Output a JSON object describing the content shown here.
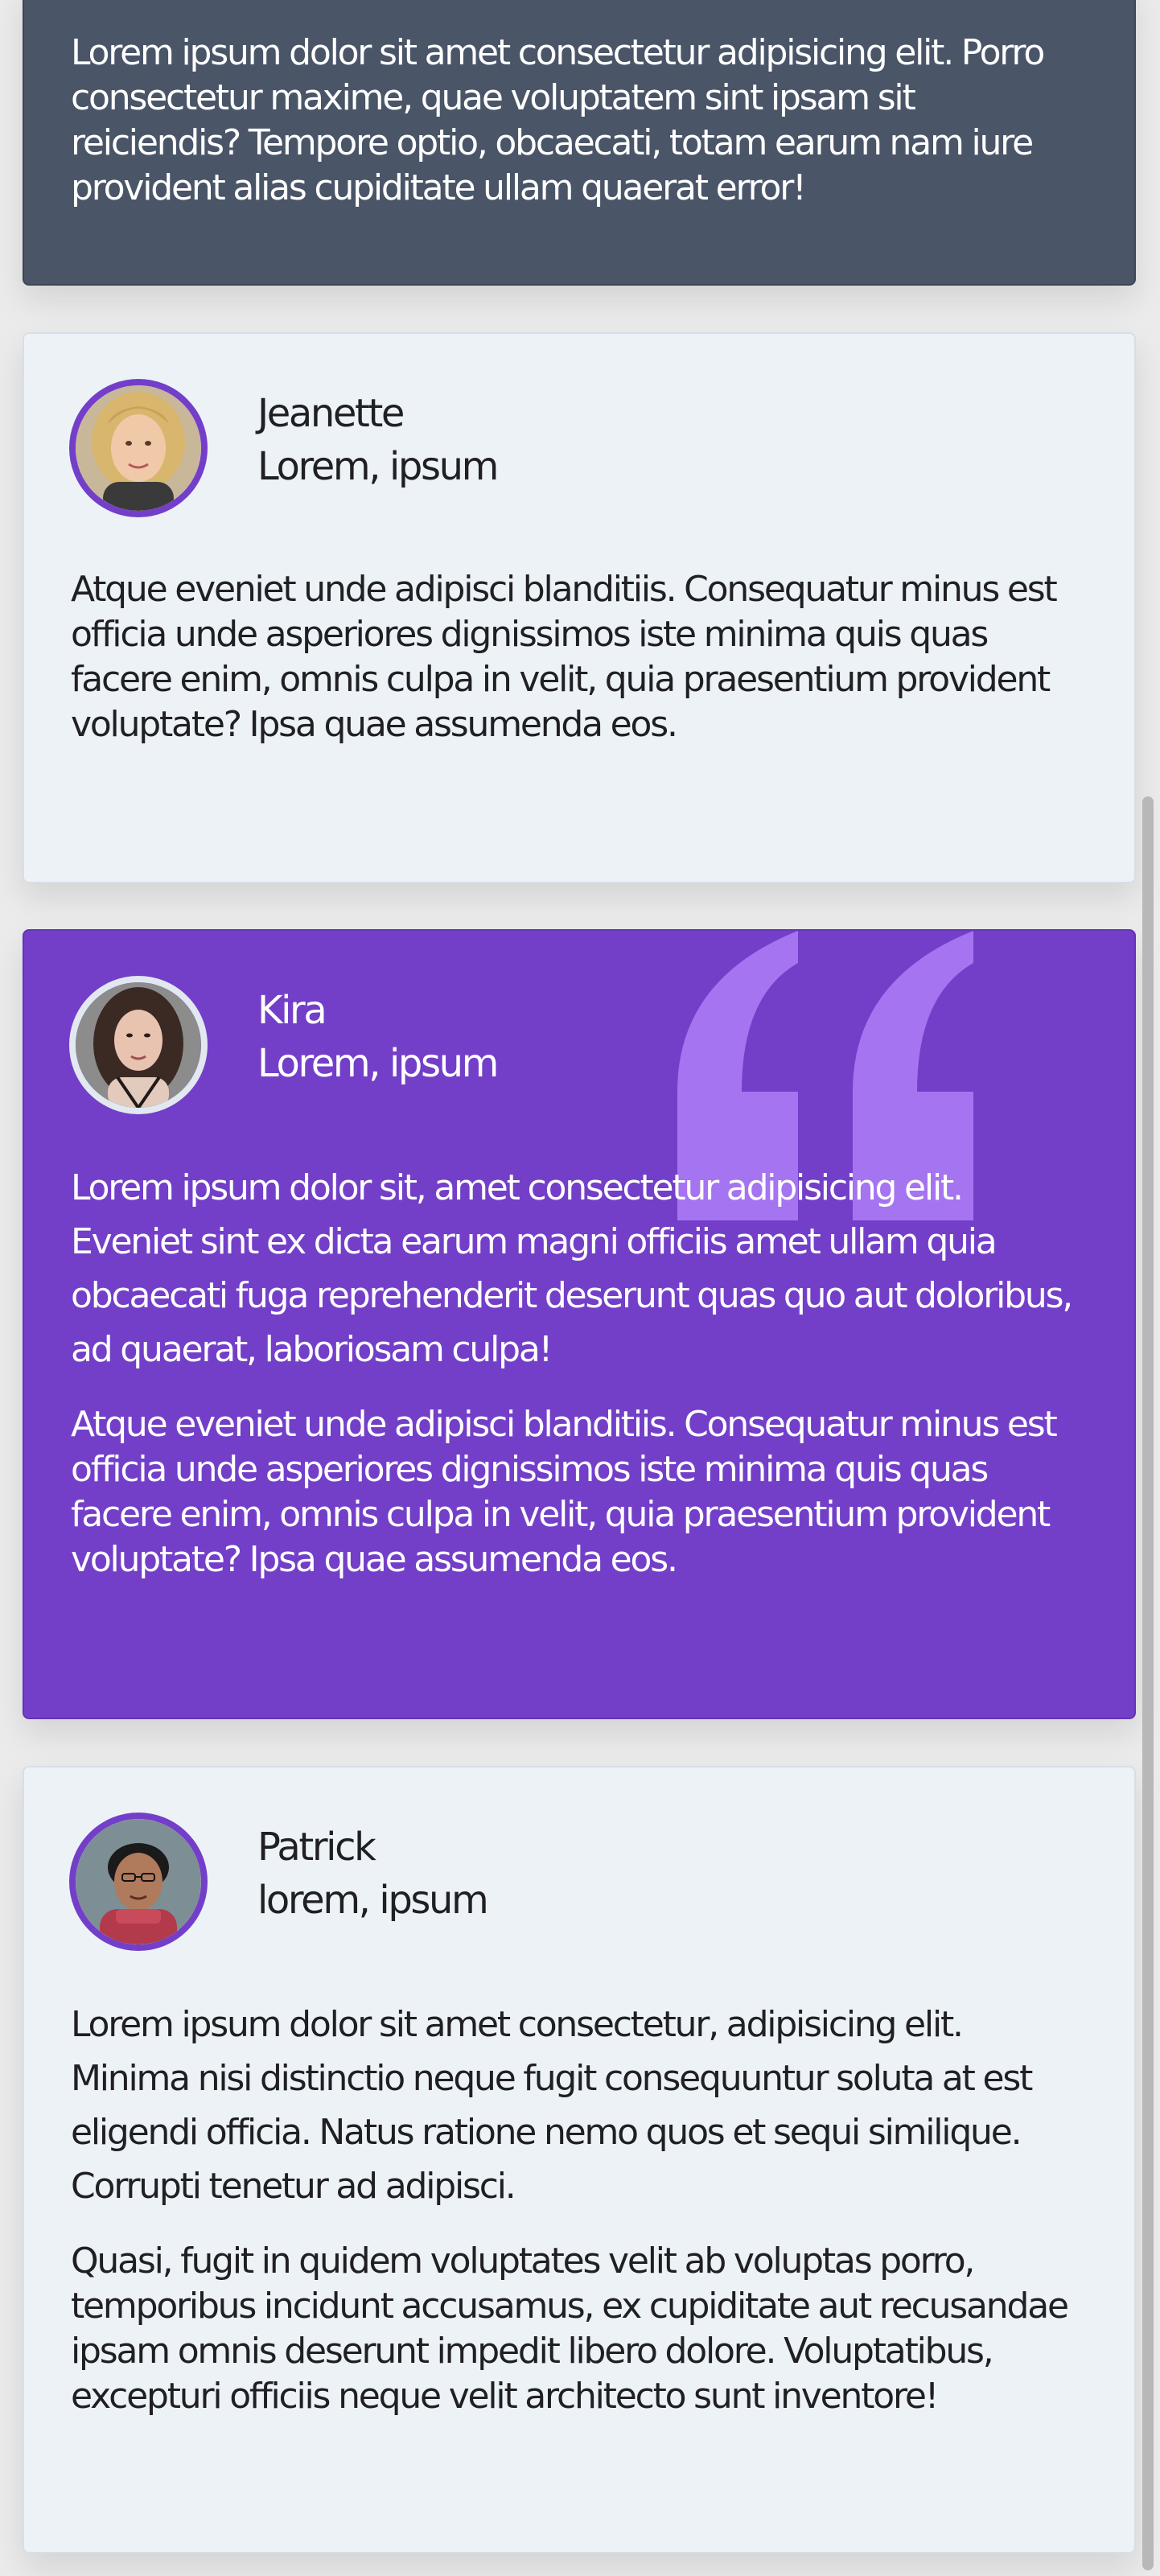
{
  "colors": {
    "page_bg": "#ebebeb",
    "slate_card": "#4a5568",
    "light_card": "#edf2f7",
    "purple": "#733fc9",
    "quote_mark": "#a574f0",
    "text_dark": "#1f1f24",
    "text_light": "#ffffff"
  },
  "top_card": {
    "text": "Lorem ipsum dolor sit amet consectetur adipisicing elit. Porro consectetur maxime, quae voluptatem sint ipsam sit reiciendis? Tempore optio, obcaecati, totam earum nam iure provident alias cupiditate ullam quaerat error!"
  },
  "testimonials": [
    {
      "name": "Jeanette",
      "role": "Lorem, ipsum",
      "avatar_icon": "avatar-photo",
      "paragraphs": [
        "Atque eveniet unde adipisci blanditiis. Consequatur minus est officia unde asperiores dignissimos iste minima quis quas facere enim, omnis culpa in velit, quia praesentium provident voluptate? Ipsa quae assumenda eos."
      ]
    },
    {
      "name": "Kira",
      "role": "Lorem, ipsum",
      "avatar_icon": "avatar-photo",
      "quote_icon": "quote-mark-icon",
      "paragraphs": [
        "Lorem ipsum dolor sit, amet consectetur adipisicing elit. Eveniet sint ex dicta earum magni officiis amet ullam quia obcaecati fuga reprehenderit deserunt quas quo aut doloribus, ad quaerat, laboriosam culpa!",
        "Atque eveniet unde adipisci blanditiis. Consequatur minus est officia unde asperiores dignissimos iste minima quis quas facere enim, omnis culpa in velit, quia praesentium provident voluptate? Ipsa quae assumenda eos."
      ]
    },
    {
      "name": "Patrick",
      "role": "lorem, ipsum",
      "avatar_icon": "avatar-photo",
      "paragraphs": [
        "Lorem ipsum dolor sit amet consectetur, adipisicing elit. Minima nisi distinctio neque fugit consequuntur soluta at est eligendi officia. Natus ratione nemo quos et sequi similique. Corrupti tenetur ad adipisci.",
        "Quasi, fugit in quidem voluptates velit ab voluptas porro, temporibus incidunt accusamus, ex cupiditate aut recusandae ipsam omnis deserunt impedit libero dolore. Voluptatibus, excepturi officiis neque velit architecto sunt inventore!"
      ]
    }
  ]
}
